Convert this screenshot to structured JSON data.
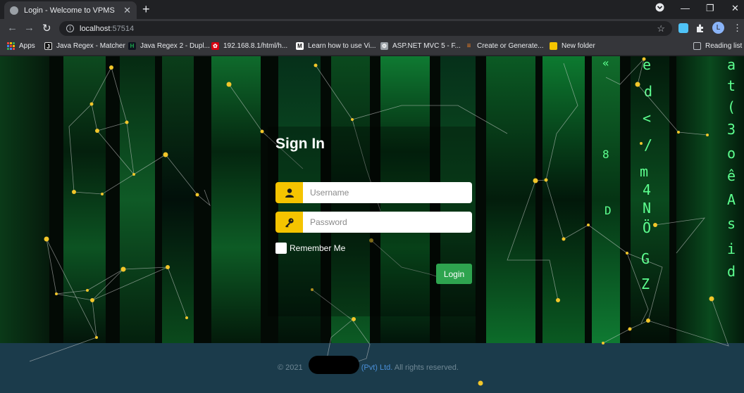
{
  "browser": {
    "tab_title": "Login - Welcome to VPMS",
    "new_tab_symbol": "+",
    "url_host": "localhost",
    "url_port": ":57514",
    "avatar_letter": "L",
    "bookmarks": [
      {
        "label": "Apps",
        "icon": "apps-grid-icon",
        "color": "#e8453c"
      },
      {
        "label": "Java Regex - Matcher",
        "icon": "j-logo-icon",
        "color": "#111111"
      },
      {
        "label": "Java Regex 2 - Dupl...",
        "icon": "hackerrank-icon",
        "color": "#1ba94c"
      },
      {
        "label": "192.168.8.1/html/h...",
        "icon": "huawei-icon",
        "color": "#d7000f"
      },
      {
        "label": "Learn how to use Vi...",
        "icon": "medium-icon",
        "color": "#111111"
      },
      {
        "label": "ASP.NET MVC 5 - F...",
        "icon": "gear-page-icon",
        "color": "#9aa0a6"
      },
      {
        "label": "Create or Generate...",
        "icon": "stackoverflow-icon",
        "color": "#f48024"
      },
      {
        "label": "New folder",
        "icon": "folder-icon",
        "color": "#f5c400"
      }
    ],
    "reading_list": "Reading list"
  },
  "login": {
    "title": "Sign In",
    "username_placeholder": "Username",
    "password_placeholder": "Password",
    "remember_label": "Remember Me",
    "login_button": "Login"
  },
  "footer": {
    "copyright_prefix": "© 2021",
    "company_suffix": "(Pvt) Ltd.",
    "rights": "All rights reserved."
  },
  "colors": {
    "accent_yellow": "#f5c400",
    "login_green": "#2ea44f",
    "footer_bg": "#1b3b4b",
    "matrix_green": "#5dff8f"
  }
}
